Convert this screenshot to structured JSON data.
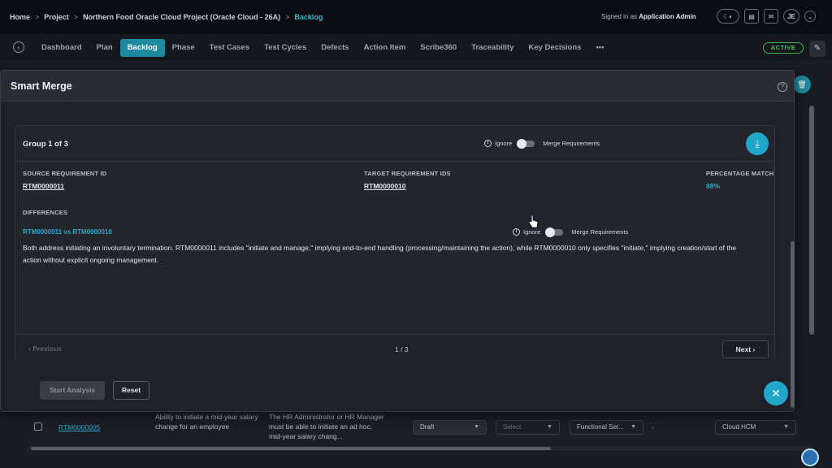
{
  "breadcrumb": {
    "items": [
      "Home",
      "Project",
      "Northern Food Oracle Cloud Project (Oracle Cloud - 26A)",
      "Backlog"
    ],
    "separator": ">"
  },
  "header": {
    "signed_in_prefix": "Signed in as",
    "signed_in_user": "Application Admin",
    "user_initials": "JE"
  },
  "nav": {
    "tabs": [
      "Dashboard",
      "Plan",
      "Backlog",
      "Phase",
      "Test Cases",
      "Test Cycles",
      "Defects",
      "Action Item",
      "Scribe360",
      "Traceability",
      "Key Decisions"
    ],
    "active_tab": "Backlog",
    "more": "•••",
    "status_badge": "ACTIVE"
  },
  "background_row": {
    "id": "RTM0000005",
    "title": "Ability to initiate a mid-year salary change for an employee",
    "description": "The HR Administrator or HR Manager must be able to initiate an ad hoc, mid-year salary chang...",
    "status": "Draft",
    "select_placeholder": "Select",
    "category": "Functional Set...",
    "dash": "-",
    "product": "Cloud HCM"
  },
  "modal": {
    "title": "Smart Merge",
    "group_title": "Group 1 of 3",
    "ignore_label": "Ignore",
    "merge_label": "Merge Requirements",
    "source_label": "SOURCE REQUIREMENT ID",
    "source_id": "RTM0000011",
    "target_label": "TARGET REQUIREMENT IDS",
    "target_id": "RTM0000010",
    "match_label": "PERCENTAGE MATCH",
    "match_value": "88%",
    "differences_label": "DIFFERENCES",
    "diff_pair": "RTM0000011 vs RTM0000010",
    "diff_text": "Both address initiating an involuntary termination. RTM0000011 includes \"initiate and manage,\" implying end-to-end handling (processing/maintaining the action), while RTM0000010 only specifies \"initiate,\" implying creation/start of the action without explicit ongoing management.",
    "prev_label": "Previous",
    "page_indicator": "1 / 3",
    "next_label": "Next",
    "start_label": "Start Analysis",
    "reset_label": "Reset"
  },
  "colors": {
    "accent": "#1fa6c9",
    "active_tab": "#1e8aa0",
    "status_green": "#4fc266",
    "background": "#0d0f14"
  }
}
